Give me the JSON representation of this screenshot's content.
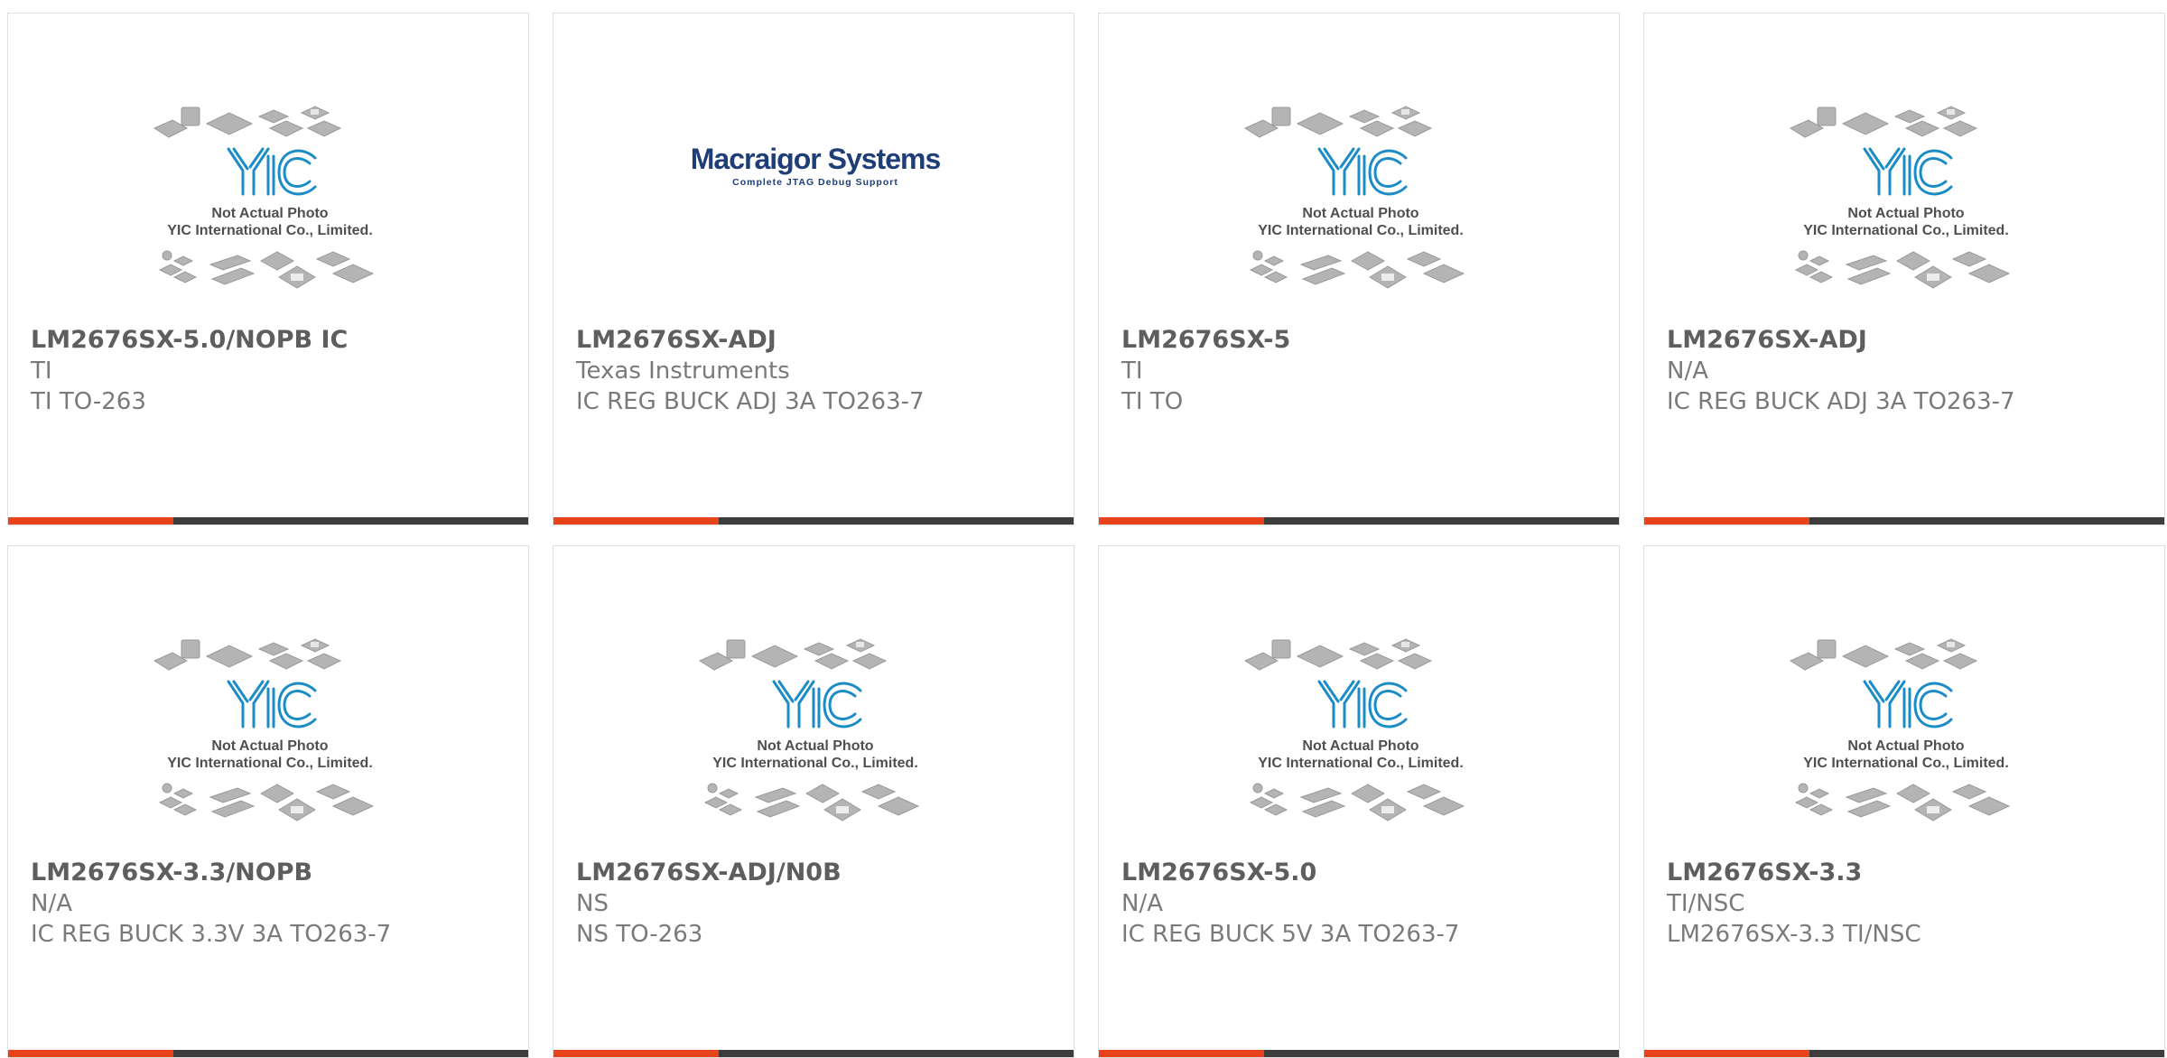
{
  "placeholder_image": {
    "logo_text": "YIC",
    "line1": "Not Actual Photo",
    "line2": "YIC International Co., Limited."
  },
  "macraigor_image": {
    "title": "Macraigor Systems",
    "subtitle": "Complete JTAG Debug Support"
  },
  "colors": {
    "accent": "#e8421a",
    "bar": "#3d3d3d",
    "yic_blue": "#1b8cc6",
    "macraigor_blue": "#1f3e77"
  },
  "products": [
    {
      "part": "LM2676SX-5.0/NOPB IC",
      "mfr": "TI",
      "desc": "TI TO-263",
      "image": "yic-placeholder"
    },
    {
      "part": "LM2676SX-ADJ",
      "mfr": "Texas Instruments",
      "desc": "IC REG BUCK ADJ 3A TO263-7",
      "image": "macraigor-logo"
    },
    {
      "part": "LM2676SX-5",
      "mfr": "TI",
      "desc": "TI TO",
      "image": "yic-placeholder"
    },
    {
      "part": "LM2676SX-ADJ",
      "mfr": "N/A",
      "desc": "IC REG BUCK ADJ 3A TO263-7",
      "image": "yic-placeholder"
    },
    {
      "part": "LM2676SX-3.3/NOPB",
      "mfr": "N/A",
      "desc": "IC REG BUCK 3.3V 3A TO263-7",
      "image": "yic-placeholder"
    },
    {
      "part": "LM2676SX-ADJ/N0B",
      "mfr": "NS",
      "desc": "NS TO-263",
      "image": "yic-placeholder"
    },
    {
      "part": "LM2676SX-5.0",
      "mfr": "N/A",
      "desc": "IC REG BUCK 5V 3A TO263-7",
      "image": "yic-placeholder"
    },
    {
      "part": "LM2676SX-3.3",
      "mfr": "TI/NSC",
      "desc": "LM2676SX-3.3 TI/NSC",
      "image": "yic-placeholder"
    }
  ]
}
